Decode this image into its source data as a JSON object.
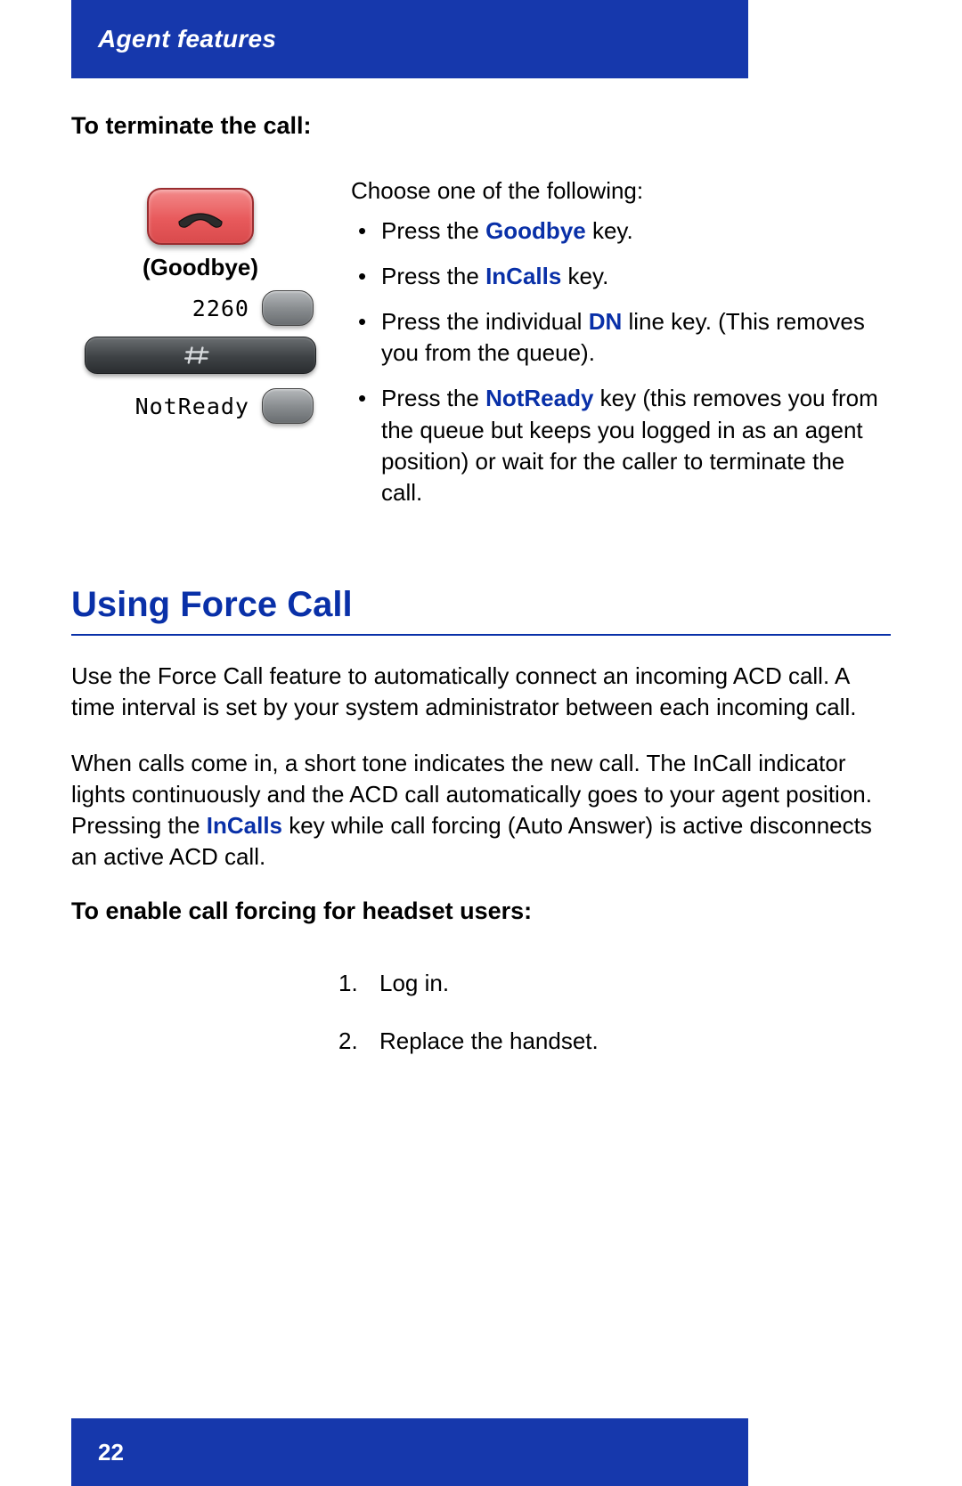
{
  "header": {
    "title": "Agent features"
  },
  "terminate": {
    "subheading": "To terminate the call:",
    "illustration": {
      "goodbye_label": "(Goodbye)",
      "dn_number": "2260",
      "not_ready_label": "NotReady"
    },
    "lead": "Choose one of the following:",
    "items": {
      "a_pre": "Press the ",
      "a_kw": "Goodbye",
      "a_post": " key.",
      "b_pre": "Press the ",
      "b_kw": "InCalls",
      "b_post": " key.",
      "c_pre": "Press the individual ",
      "c_kw": "DN",
      "c_post": " line key. (This removes you from the queue).",
      "d_pre": "Press the ",
      "d_kw": "NotReady",
      "d_post": " key (this removes you from the queue but keeps you logged in as an agent position) or wait for the caller to terminate the call."
    }
  },
  "force_call": {
    "title": "Using Force Call",
    "para1": "Use the Force Call feature to automatically connect an incoming ACD call. A time interval is set by your system administrator between each incoming call.",
    "para2_pre": "When calls come in, a short tone indicates the new call. The InCall indicator lights continuously and the ACD call automatically goes to your agent position. Pressing the ",
    "para2_kw": "InCalls",
    "para2_post": " key while call forcing (Auto Answer) is active disconnects an active ACD call.",
    "enable_heading": "To enable call forcing for headset users:",
    "steps": {
      "s1_num": "1.",
      "s1_text": "Log in.",
      "s2_num": "2.",
      "s2_text": "Replace the handset."
    }
  },
  "footer": {
    "page_number": "22"
  }
}
